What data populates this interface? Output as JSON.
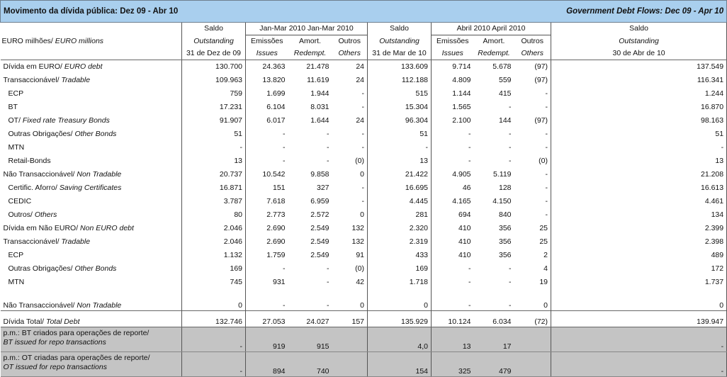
{
  "banner": {
    "left": "Movimento da dívida pública: Dez 09 - Abr 10",
    "right": "Government Debt Flows: Dec 09 - Apr 10"
  },
  "header": {
    "unit_pt": "EURO milhões/",
    "unit_en": "EURO millions",
    "group1": "Jan-Mar 2010 Jan-Mar 2010",
    "group2": "Abril 2010 April 2010",
    "saldo": "Saldo",
    "outstanding": "Outstanding",
    "date1": "31 de Dez de 09",
    "date2": "31 de Mar de 10",
    "date3": "30 de Abr de 10",
    "issues_pt": "Emissões",
    "issues_en": "Issues",
    "amort_pt": "Amort.",
    "amort_en": "Redempt.",
    "others_pt": "Outros",
    "others_en": "Others"
  },
  "rows": [
    {
      "pt": "Dívida em EURO/",
      "en": "EURO debt",
      "indent": false,
      "v": [
        "130.700",
        "24.363",
        "21.478",
        "24",
        "133.609",
        "9.714",
        "5.678",
        "(97)",
        "137.549"
      ]
    },
    {
      "pt": "Transaccionável/",
      "en": "Tradable",
      "indent": false,
      "v": [
        "109.963",
        "13.820",
        "11.619",
        "24",
        "112.188",
        "4.809",
        "559",
        "(97)",
        "116.341"
      ]
    },
    {
      "pt": "ECP",
      "en": "",
      "indent": true,
      "v": [
        "759",
        "1.699",
        "1.944",
        "-",
        "515",
        "1.144",
        "415",
        "-",
        "1.244"
      ]
    },
    {
      "pt": "BT",
      "en": "",
      "indent": true,
      "v": [
        "17.231",
        "6.104",
        "8.031",
        "-",
        "15.304",
        "1.565",
        "-",
        "-",
        "16.870"
      ]
    },
    {
      "pt": "OT/",
      "en": "Fixed rate Treasury Bonds",
      "indent": true,
      "v": [
        "91.907",
        "6.017",
        "1.644",
        "24",
        "96.304",
        "2.100",
        "144",
        "(97)",
        "98.163"
      ]
    },
    {
      "pt": "Outras Obrigações/",
      "en": "Other Bonds",
      "indent": true,
      "v": [
        "51",
        "-",
        "-",
        "-",
        "51",
        "-",
        "-",
        "-",
        "51"
      ]
    },
    {
      "pt": "MTN",
      "en": "",
      "indent": true,
      "v": [
        "-",
        "-",
        "-",
        "-",
        "-",
        "-",
        "-",
        "-",
        "-"
      ]
    },
    {
      "pt": "Retail-Bonds",
      "en": "",
      "indent": true,
      "v": [
        "13",
        "-",
        "-",
        "(0)",
        "13",
        "-",
        "-",
        "(0)",
        "13"
      ]
    },
    {
      "pt": "Não Transaccionável/",
      "en": "Non Tradable",
      "indent": false,
      "v": [
        "20.737",
        "10.542",
        "9.858",
        "0",
        "21.422",
        "4.905",
        "5.119",
        "-",
        "21.208"
      ]
    },
    {
      "pt": "Certific. Aforro/",
      "en": "Saving Certificates",
      "indent": true,
      "v": [
        "16.871",
        "151",
        "327",
        "-",
        "16.695",
        "46",
        "128",
        "-",
        "16.613"
      ]
    },
    {
      "pt": "CEDIC",
      "en": "",
      "indent": true,
      "v": [
        "3.787",
        "7.618",
        "6.959",
        "-",
        "4.445",
        "4.165",
        "4.150",
        "-",
        "4.461"
      ]
    },
    {
      "pt": "Outros/",
      "en": "Others",
      "indent": true,
      "v": [
        "80",
        "2.773",
        "2.572",
        "0",
        "281",
        "694",
        "840",
        "-",
        "134"
      ]
    },
    {
      "pt": "Dívida em Não EURO/",
      "en": "Non EURO debt",
      "indent": false,
      "v": [
        "2.046",
        "2.690",
        "2.549",
        "132",
        "2.320",
        "410",
        "356",
        "25",
        "2.399"
      ]
    },
    {
      "pt": "Transaccionável/",
      "en": "Tradable",
      "indent": false,
      "v": [
        "2.046",
        "2.690",
        "2.549",
        "132",
        "2.319",
        "410",
        "356",
        "25",
        "2.398"
      ]
    },
    {
      "pt": "ECP",
      "en": "",
      "indent": true,
      "v": [
        "1.132",
        "1.759",
        "2.549",
        "91",
        "433",
        "410",
        "356",
        "2",
        "489"
      ]
    },
    {
      "pt": "Outras Obrigações/",
      "en": "Other Bonds",
      "indent": true,
      "v": [
        "169",
        "-",
        "-",
        "(0)",
        "169",
        "-",
        "-",
        "4",
        "172"
      ]
    },
    {
      "pt": "MTN",
      "en": "",
      "indent": true,
      "v": [
        "745",
        "931",
        "-",
        "42",
        "1.718",
        "-",
        "-",
        "19",
        "1.737"
      ]
    },
    {
      "pt": "Não Transaccionável/",
      "en": "Non Tradable",
      "indent": false,
      "tall": true,
      "v": [
        "0",
        "-",
        "-",
        "0",
        "0",
        "-",
        "-",
        "0",
        "0"
      ]
    }
  ],
  "total": {
    "pt": "Dívida Total/",
    "en": "Total Debt",
    "v": [
      "132.746",
      "27.053",
      "24.027",
      "157",
      "135.929",
      "10.124",
      "6.034",
      "(72)",
      "139.947"
    ]
  },
  "memo": [
    {
      "pt": "p.m.: BT criados para operações de reporte/",
      "en": "BT issued for repo transactions",
      "v": [
        "-",
        "919",
        "915",
        "",
        "4,0",
        "13",
        "17",
        "",
        "-"
      ]
    },
    {
      "pt": "p.m.: OT criadas para operações de reporte/",
      "en": "OT issued for repo transactions",
      "v": [
        "-",
        "894",
        "740",
        "",
        "154",
        "325",
        "479",
        "",
        "-"
      ]
    }
  ]
}
